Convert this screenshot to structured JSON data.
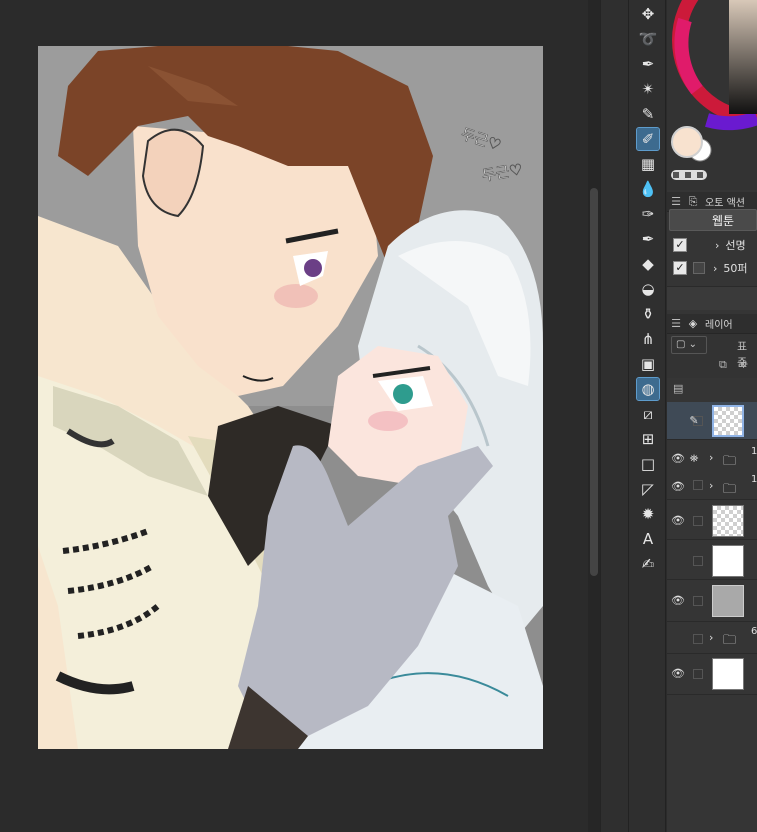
{
  "auto_action": {
    "title": "오토 액션",
    "button_label": "웹툰",
    "items": [
      {
        "checked": true,
        "label": "선명"
      },
      {
        "checked": true,
        "label": "50퍼"
      }
    ]
  },
  "layer_panel": {
    "title": "레이어",
    "blend_mode": "표준",
    "layers": [
      {
        "type": "raster",
        "selected": true,
        "visible": false,
        "label": ""
      },
      {
        "type": "folder",
        "visible": true,
        "label": "1"
      },
      {
        "type": "folder",
        "visible": true,
        "label": "1"
      },
      {
        "type": "raster",
        "visible": true,
        "label": ""
      },
      {
        "type": "raster",
        "visible": false,
        "label": ""
      },
      {
        "type": "raster",
        "visible": true,
        "label": ""
      },
      {
        "type": "folder",
        "visible": false,
        "label": "6"
      },
      {
        "type": "paper",
        "visible": true,
        "label": ""
      }
    ]
  },
  "canvas": {
    "sfx_1": "두근♡",
    "sfx_2": "두근♡"
  },
  "colors": {
    "main_color": "#f8e2cf",
    "sub_color": "#ffffff",
    "background": "#2b2b2b"
  },
  "tools": [
    "move-icon",
    "lasso-icon",
    "eyedropper-icon",
    "magic-wand-icon",
    "pen-icon",
    "g-pen-icon",
    "grid-icon",
    "blend-icon",
    "brush-icon",
    "airbrush-icon",
    "eraser-icon",
    "fill-icon",
    "stamp-icon",
    "grass-icon",
    "gradient-icon",
    "shape-icon",
    "ruler-icon",
    "frame-icon",
    "rectangle-icon",
    "balloon-icon",
    "burst-icon",
    "text-icon",
    "correction-icon"
  ]
}
